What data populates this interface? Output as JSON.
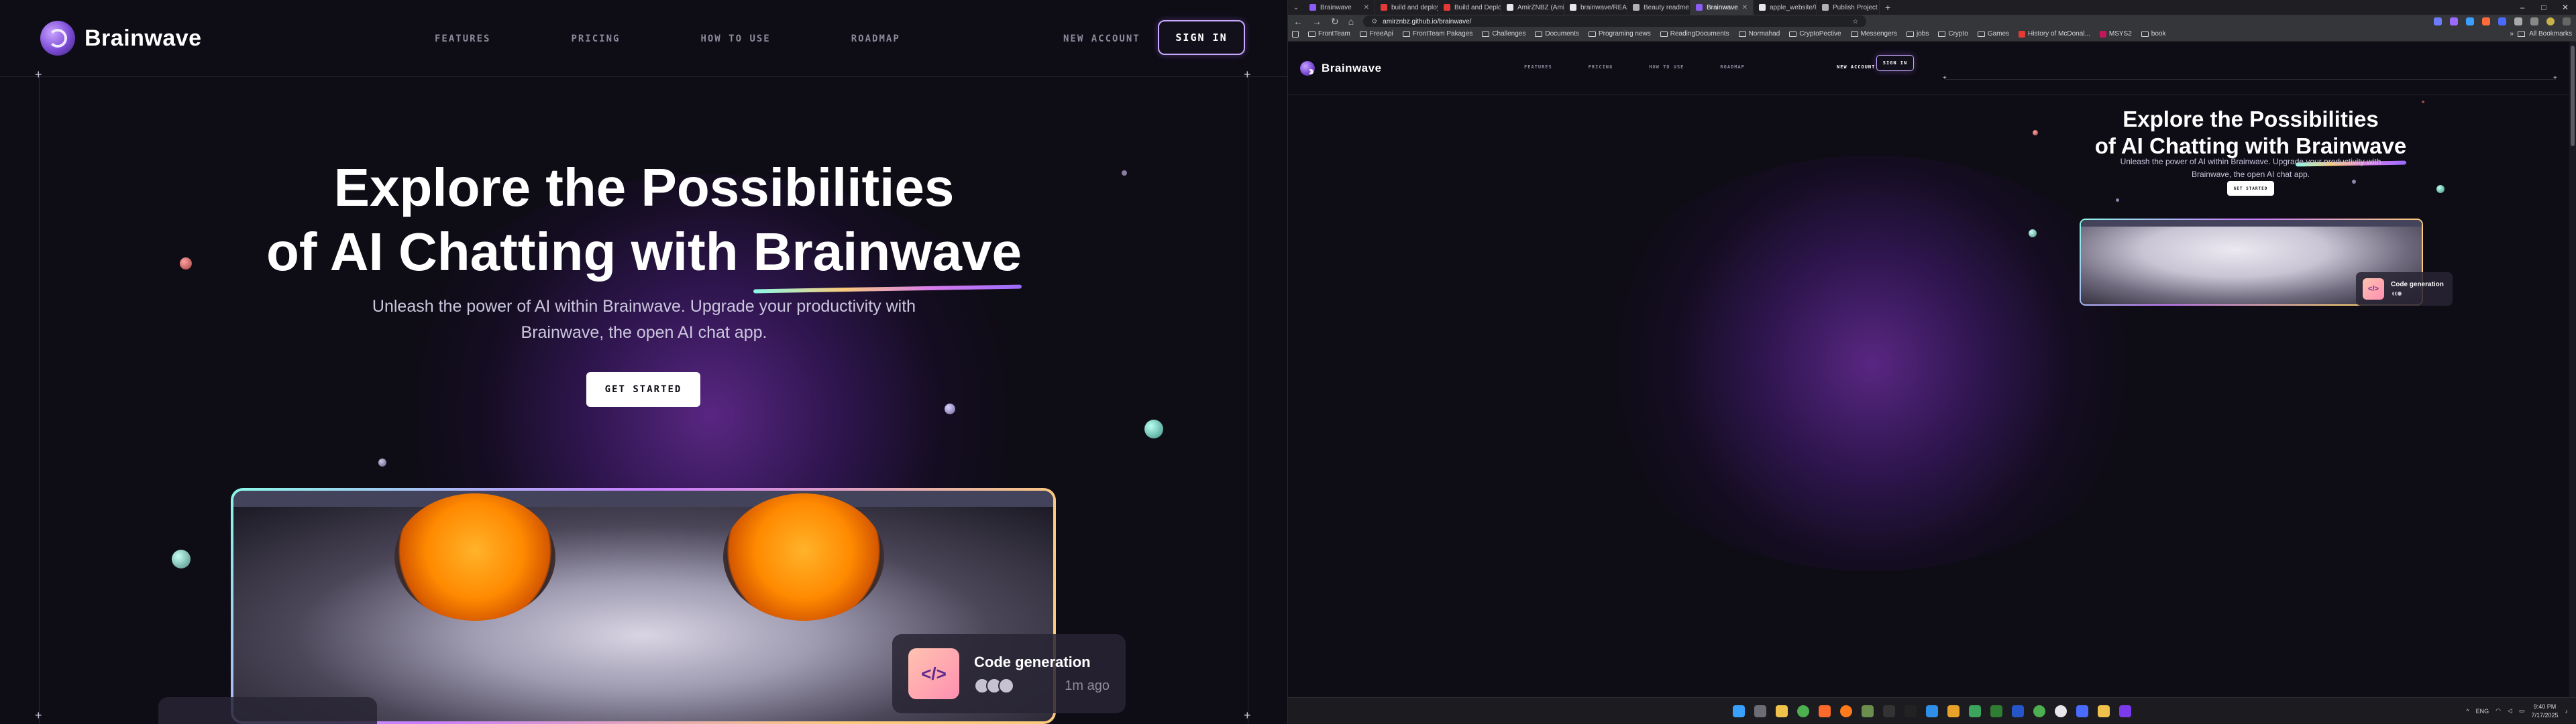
{
  "brand": {
    "name": "Brainwave"
  },
  "nav": [
    "FEATURES",
    "PRICING",
    "HOW TO USE",
    "ROADMAP"
  ],
  "auth": {
    "new_account": "NEW ACCOUNT",
    "sign_in": "SIGN IN"
  },
  "hero": {
    "title_line1": "Explore the Possibilities",
    "title_line2_prefix": "of AI Chatting with ",
    "title_accent": "Brainwave",
    "subtitle_line1": "Unleash the power of AI within Brainwave. Upgrade your productivity with",
    "subtitle_line2": "Brainwave, the open AI chat app.",
    "cta": "GET STARTED"
  },
  "preview_card": {
    "title": "Code generation",
    "time": "1m ago"
  },
  "browser": {
    "tabs": [
      {
        "label": "Brainwave",
        "color": "#8b5cf6"
      },
      {
        "label": "build and deploy 3 m",
        "color": "#e53935"
      },
      {
        "label": "Build and Deploy 3 M",
        "color": "#e53935"
      },
      {
        "label": "AmirZNBZ (Amirsalar",
        "color": "#e8e8ea"
      },
      {
        "label": "brainwave/README.m",
        "color": "#e8e8ea"
      },
      {
        "label": "Beauty readme for G",
        "color": "#b0b0b6"
      },
      {
        "label": "Brainwave",
        "color": "#8b5cf6",
        "active": true
      },
      {
        "label": "apple_website/READ",
        "color": "#e8e8ea"
      },
      {
        "label": "Publish Project In Git",
        "color": "#b0b0b6"
      }
    ],
    "url": "amirznbz.github.io/brainwave/",
    "bookmarks": [
      "FrontTeam",
      "FreeApi",
      "FrontTeam Pakages",
      "Challenges",
      "Documents",
      "Programing news",
      "ReadingDocuments",
      "Normahad",
      "CryptoPective",
      "Messengers",
      "jobs",
      "Crypto",
      "Games",
      "History of McDonal...",
      "MSYS2",
      "book"
    ],
    "all_bookmarks": "All Bookmarks"
  },
  "system": {
    "lang": "ENG",
    "time": "9:40 PM",
    "date": "7/17/2025"
  },
  "colors": {
    "background": "#0e0c15",
    "accent_purple": "#ac6aff",
    "gradient_teal": "#89f9e8",
    "gradient_yellow": "#facb7b",
    "gradient_pink": "#d87cee"
  }
}
